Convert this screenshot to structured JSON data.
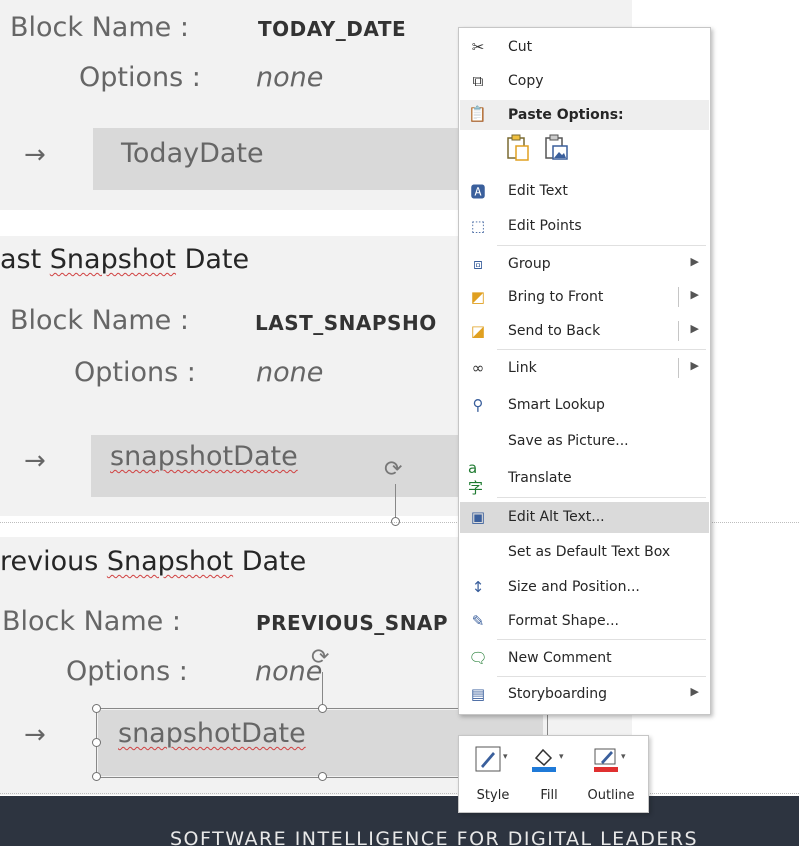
{
  "slide": {
    "sections": [
      {
        "heading": "",
        "block_label": "Block Name :",
        "block_value": "TODAY_DATE",
        "options_label": "Options :",
        "options_value": "none",
        "arrow": "→",
        "field": "TodayDate"
      },
      {
        "heading_prefix": "ast ",
        "heading_word": "Snapshot",
        "heading_suffix": " Date",
        "block_label": "Block Name :",
        "block_value": "LAST_SNAPSHO",
        "options_label": "Options :",
        "options_value": "none",
        "arrow": "→",
        "field": "snapshotDate"
      },
      {
        "heading_prefix": "revious ",
        "heading_word": "Snapshot",
        "heading_suffix": " Date",
        "block_label": "Block Name :",
        "block_value": "PREVIOUS_SNAP",
        "options_label": "Options :",
        "options_value": "none",
        "arrow": "→",
        "field": "snapshotDate"
      }
    ],
    "footer": "SOFTWARE INTELLIGENCE FOR DIGITAL LEADERS"
  },
  "context_menu": {
    "paste_options_label": "Paste Options:",
    "items": [
      {
        "label": "Cut",
        "icon": "scissors-icon"
      },
      {
        "label": "Copy",
        "icon": "copy-icon"
      },
      {
        "label": "Edit Text",
        "icon": "edit-text-icon"
      },
      {
        "label": "Edit Points",
        "icon": "edit-points-icon"
      },
      {
        "label": "Group",
        "icon": "group-icon",
        "submenu": true
      },
      {
        "label": "Bring to Front",
        "icon": "bring-to-front-icon",
        "submenu": true
      },
      {
        "label": "Send to Back",
        "icon": "send-to-back-icon",
        "submenu": true
      },
      {
        "label": "Link",
        "icon": "link-icon",
        "submenu": true
      },
      {
        "label": "Smart Lookup",
        "icon": "smart-lookup-icon"
      },
      {
        "label": "Save as Picture...",
        "icon": ""
      },
      {
        "label": "Translate",
        "icon": "translate-icon"
      },
      {
        "label": "Edit Alt Text...",
        "icon": "alt-text-icon",
        "highlighted": true
      },
      {
        "label": "Set as Default Text Box",
        "icon": ""
      },
      {
        "label": "Size and Position...",
        "icon": "size-position-icon"
      },
      {
        "label": "Format Shape...",
        "icon": "format-shape-icon"
      },
      {
        "label": "New Comment",
        "icon": "new-comment-icon"
      },
      {
        "label": "Storyboarding",
        "icon": "storyboarding-icon",
        "submenu": true
      }
    ]
  },
  "mini_toolbar": {
    "style_label": "Style",
    "fill_label": "Fill",
    "outline_label": "Outline",
    "fill_color": "#1f7ad8",
    "outline_color": "#e03030"
  }
}
